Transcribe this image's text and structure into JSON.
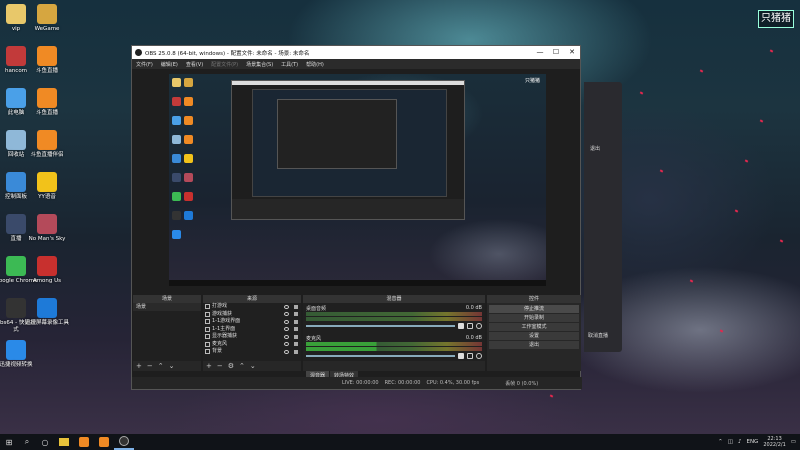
{
  "brand_logo": "只猪猪",
  "desktop_icons": [
    {
      "label": "vip",
      "color": "#e8c86a"
    },
    {
      "label": "WeGame",
      "color": "#d6a640"
    },
    {
      "label": "hancom",
      "color": "#c23a3a"
    },
    {
      "label": "斗鱼直播",
      "color": "#f08a24"
    },
    {
      "label": "此电脑",
      "color": "#4aa0e8"
    },
    {
      "label": "斗鱼直播",
      "color": "#f08a24"
    },
    {
      "label": "回收站",
      "color": "#8fb8d8"
    },
    {
      "label": "斗鱼直播伴侣",
      "color": "#f08a24"
    },
    {
      "label": "控制面板",
      "color": "#3a8ad8"
    },
    {
      "label": "YY语音",
      "color": "#f2c21a"
    },
    {
      "label": "直播",
      "color": "#3a4a6a"
    },
    {
      "label": "No Man's Sky",
      "color": "#b44a5a"
    },
    {
      "label": "Google Chrome",
      "color": "#3cba54"
    },
    {
      "label": "Among Us",
      "color": "#c8302e"
    },
    {
      "label": "obs64 - 快捷方式",
      "color": "#333"
    },
    {
      "label": "迅捷屏幕录像工具",
      "color": "#1e7ad8"
    },
    {
      "label": "迅捷视频转换",
      "color": "#2a8ae8"
    }
  ],
  "obs": {
    "title": "OBS 25.0.8 (64-bit, windows) - 配置文件: 未命名 - 场景: 未命名",
    "window_controls": [
      "—",
      "☐",
      "✕"
    ],
    "menu": [
      "文件(F)",
      "编辑(E)",
      "查看(V)",
      "配置文件(P)",
      "场景集合(S)",
      "工具(T)",
      "帮助(H)"
    ],
    "docks": {
      "scenes": {
        "header": "场景",
        "items": [
          "场景"
        ]
      },
      "sources": {
        "header": "来源",
        "items": [
          "打游戏",
          "游戏捕获",
          "1-1游戏界面",
          "1-1主界面",
          "显示器捕获",
          "麦克风",
          "背景"
        ]
      },
      "mixer": {
        "header": "混音器",
        "channels": [
          {
            "name": "桌面音频",
            "db": "0.0 dB"
          },
          {
            "name": "麦克风",
            "db": "0.0 dB"
          }
        ]
      },
      "controls": {
        "header": "控件",
        "buttons": [
          "停止推流",
          "开始录制",
          "工作室模式",
          "设置",
          "退出"
        ]
      }
    },
    "tabs": [
      "混音器",
      "转场特效"
    ],
    "status": {
      "live": "LIVE: 00:00:00",
      "rec": "REC: 00:00:00",
      "cpu": "CPU: 0.4%, 30.00 fps",
      "dropped": "丢帧 0 (0.0%)"
    }
  },
  "right_panel": {
    "exit": "退出",
    "cancel": "取消直播"
  },
  "taskbar": {
    "search_icon": "search",
    "apps": [
      "file-explorer",
      "app-orange-1",
      "app-orange-2",
      "obs"
    ],
    "tray": {
      "lang": "ENG",
      "time": "22:13",
      "date": "2022/2/1"
    }
  }
}
